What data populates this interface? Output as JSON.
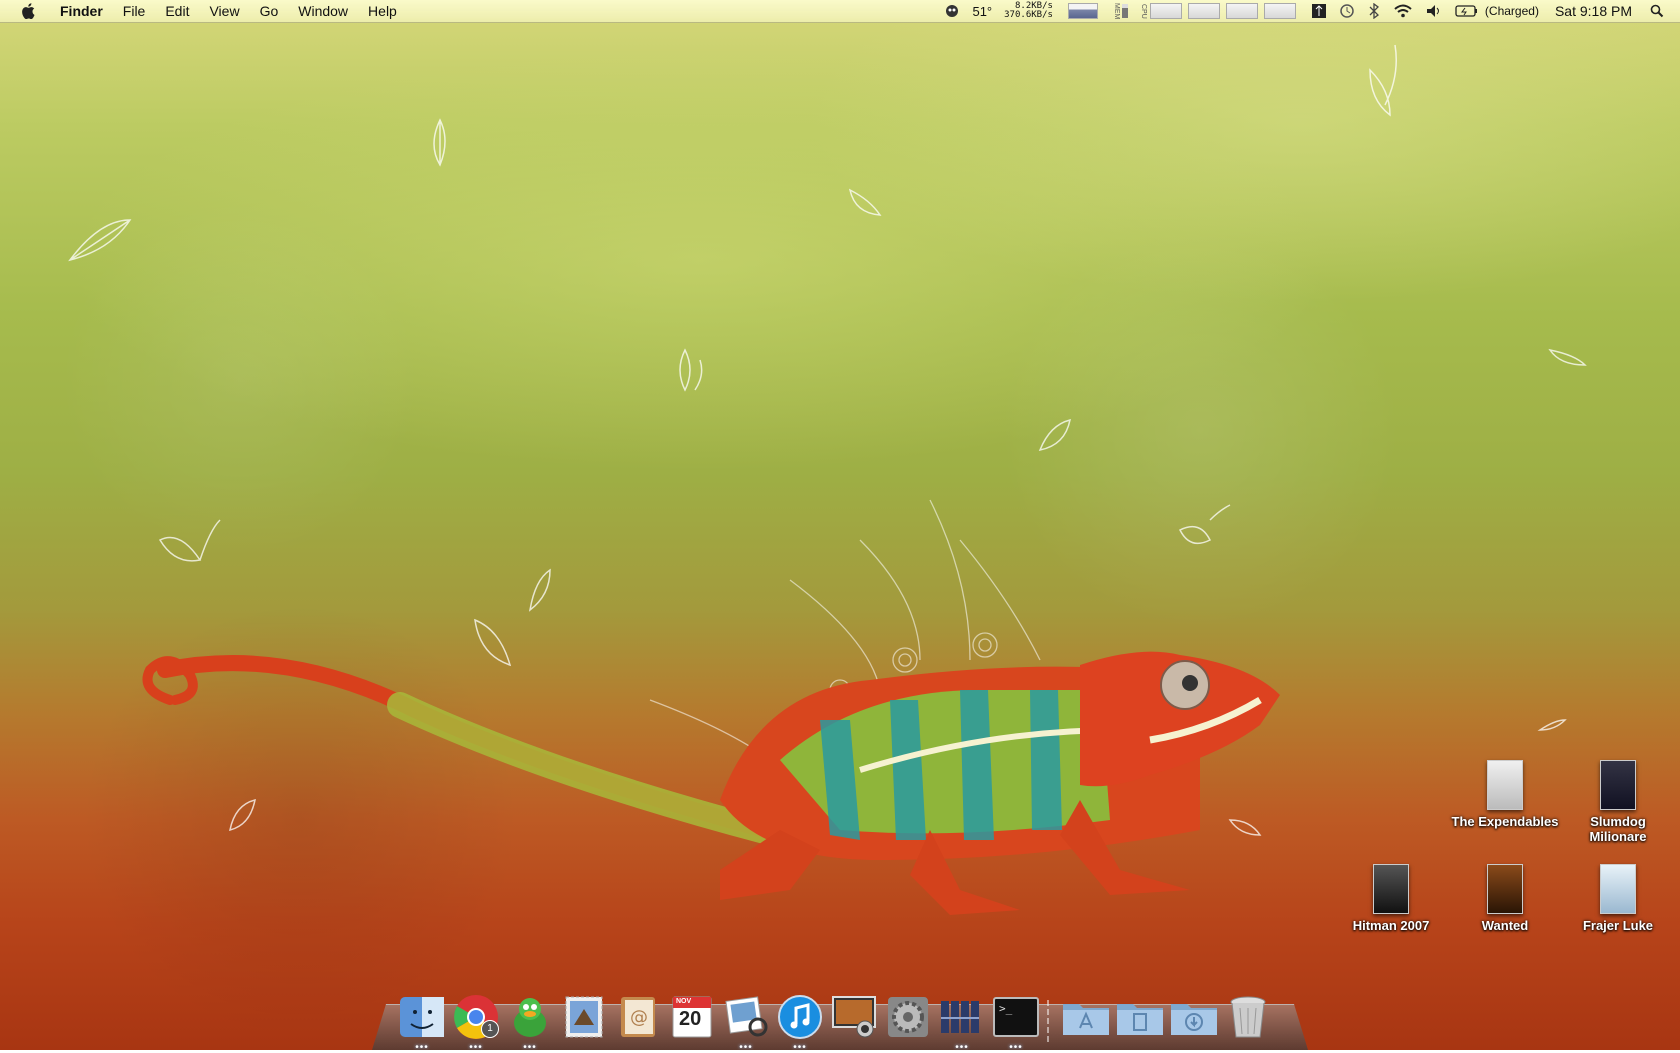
{
  "menubar": {
    "app_name": "Finder",
    "items": [
      "File",
      "Edit",
      "View",
      "Go",
      "Window",
      "Help"
    ],
    "temperature": "51°",
    "net_up": "8.2KB/s",
    "net_down": "370.6KB/s",
    "mem_label": "MEM",
    "cpu_label": "CPU",
    "battery_status": "(Charged)",
    "clock": "Sat 9:18 PM",
    "icons": [
      "apple-logo-icon",
      "system-monitor-icon",
      "time-machine-icon",
      "bluetooth-icon",
      "wifi-icon",
      "volume-icon",
      "battery-icon",
      "spotlight-icon"
    ]
  },
  "desktop": {
    "icons": [
      {
        "label": "The Expendables",
        "thumb_color": "#e8e8e8"
      },
      {
        "label": "Slumdog Milionare",
        "thumb_color": "#1f2a55"
      },
      {
        "label": "Hitman 2007",
        "thumb_color": "#2a2a2a"
      },
      {
        "label": "Wanted",
        "thumb_color": "#5a2a10"
      },
      {
        "label": "Frajer Luke",
        "thumb_color": "#cfe0ee"
      }
    ]
  },
  "dock": {
    "calendar_month": "NOV",
    "calendar_day": "20",
    "chrome_badge": "1",
    "terminal_prompt": ">_",
    "items": [
      "finder",
      "chrome",
      "adium",
      "mail",
      "address-book",
      "ical",
      "preview",
      "itunes",
      "photo-booth",
      "system-preferences",
      "istat",
      "terminal",
      "applications",
      "documents",
      "downloads",
      "trash"
    ]
  }
}
